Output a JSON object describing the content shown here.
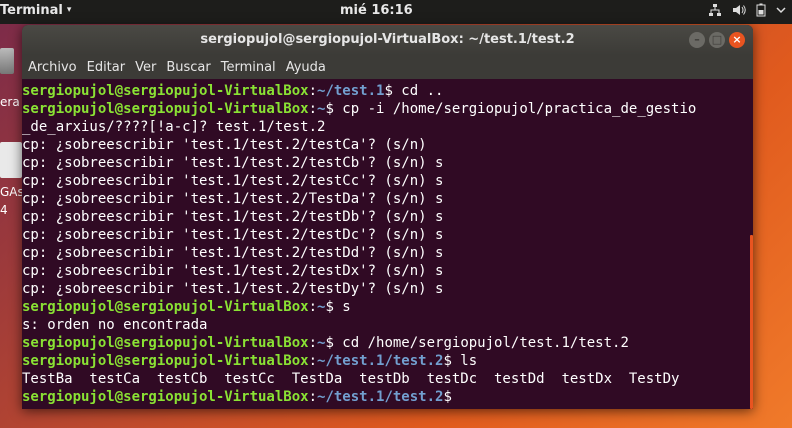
{
  "topbar": {
    "app_name": "Terminal",
    "app_caret": "▾",
    "clock": "mié 16:16",
    "tray_icons": [
      "network-icon",
      "volume-icon",
      "battery-icon",
      "power-menu-icon"
    ]
  },
  "desktop": {
    "trash_label": "era",
    "vbox_label_1": "GAs",
    "vbox_label_2": "4"
  },
  "window": {
    "title": "sergiopujol@sergiopujol-VirtualBox: ~/test.1/test.2",
    "buttons": {
      "minimize": "–",
      "maximize": "□",
      "close": "×"
    },
    "menu": [
      "Archivo",
      "Editar",
      "Ver",
      "Buscar",
      "Terminal",
      "Ayuda"
    ]
  },
  "terminal": {
    "lines": [
      {
        "user": "sergiopujol@sergiopujol-VirtualBox",
        "sep": ":",
        "path": "~/test.1",
        "rest": "$ cd .."
      },
      {
        "user": "sergiopujol@sergiopujol-VirtualBox",
        "sep": ":",
        "path": "~",
        "rest": "$ cp -i /home/sergiopujol/practica_de_gestio"
      },
      {
        "text": "_de_arxius/????[!a-c]? test.1/test.2"
      },
      {
        "text": "cp: ¿sobreescribir 'test.1/test.2/testCa'? (s/n)"
      },
      {
        "text": "cp: ¿sobreescribir 'test.1/test.2/testCb'? (s/n) s"
      },
      {
        "text": "cp: ¿sobreescribir 'test.1/test.2/testCc'? (s/n) s"
      },
      {
        "text": "cp: ¿sobreescribir 'test.1/test.2/TestDa'? (s/n) s"
      },
      {
        "text": "cp: ¿sobreescribir 'test.1/test.2/testDb'? (s/n) s"
      },
      {
        "text": "cp: ¿sobreescribir 'test.1/test.2/testDc'? (s/n) s"
      },
      {
        "text": "cp: ¿sobreescribir 'test.1/test.2/testDd'? (s/n) s"
      },
      {
        "text": "cp: ¿sobreescribir 'test.1/test.2/testDx'? (s/n) s"
      },
      {
        "text": "cp: ¿sobreescribir 'test.1/test.2/testDy'? (s/n) s"
      },
      {
        "user": "sergiopujol@sergiopujol-VirtualBox",
        "sep": ":",
        "path": "~",
        "rest": "$ s"
      },
      {
        "text": "s: orden no encontrada"
      },
      {
        "user": "sergiopujol@sergiopujol-VirtualBox",
        "sep": ":",
        "path": "~",
        "rest": "$ cd /home/sergiopujol/test.1/test.2"
      },
      {
        "user": "sergiopujol@sergiopujol-VirtualBox",
        "sep": ":",
        "path": "~/test.1/test.2",
        "rest": "$ ls"
      },
      {
        "text": "TestBa  testCa  testCb  testCc  TestDa  testDb  testDc  testDd  testDx  TestDy"
      },
      {
        "user": "sergiopujol@sergiopujol-VirtualBox",
        "sep": ":",
        "path": "~/test.1/test.2",
        "rest": "$"
      }
    ]
  },
  "colors": {
    "terminal_bg": "#300a24",
    "prompt_user": "#8ae234",
    "prompt_path": "#729fcf",
    "accent": "#e95420"
  }
}
